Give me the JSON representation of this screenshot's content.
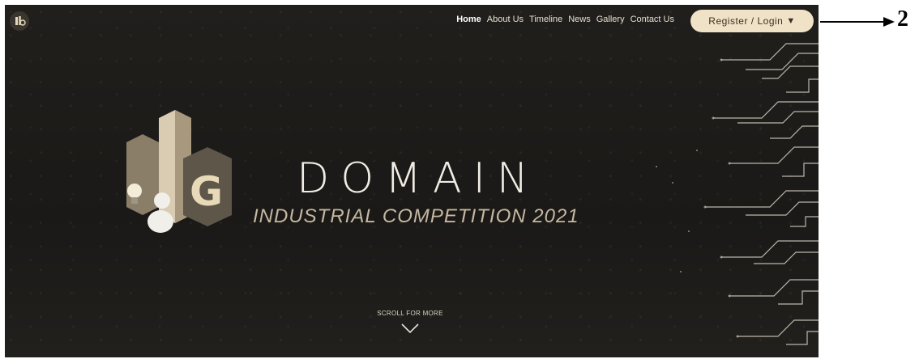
{
  "nav": {
    "items": [
      {
        "label": "Home"
      },
      {
        "label": "About Us"
      },
      {
        "label": "Timeline"
      },
      {
        "label": "News"
      },
      {
        "label": "Gallery"
      },
      {
        "label": "Contact Us"
      }
    ],
    "register_label": "Register / Login",
    "register_caret": "▼"
  },
  "hero": {
    "title": "DOMAIN",
    "subtitle": "INDUSTRIAL COMPETITION 2021",
    "scroll_label": "SCROLL FOR MORE"
  },
  "annotation": {
    "label": "2"
  },
  "colors": {
    "background": "#1c1b19",
    "accent": "#efe2c6",
    "subtitle": "#c6b8a0"
  }
}
